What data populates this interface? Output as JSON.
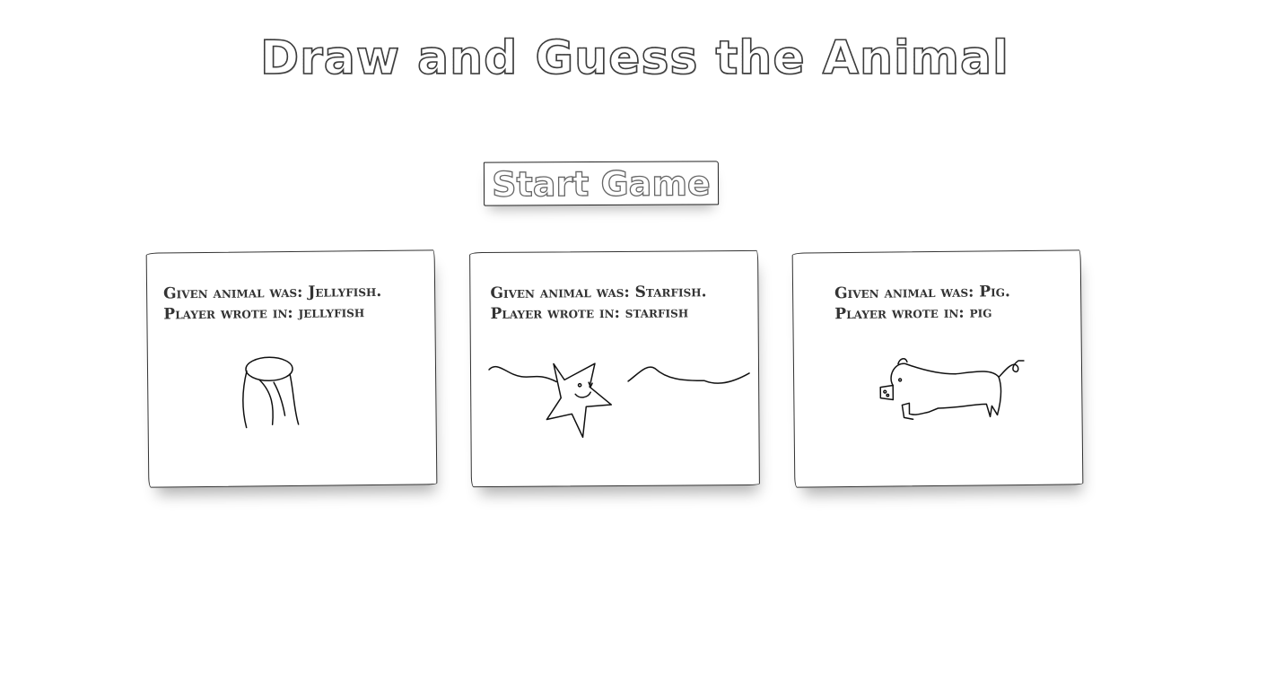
{
  "page": {
    "title": "Draw and Guess the Animal"
  },
  "controls": {
    "start_label": "Start Game"
  },
  "cards": [
    {
      "given": "Given animal was: Jellyfish.",
      "wrote": "Player wrote in: jellyfish",
      "drawing": "jellyfish-drawing"
    },
    {
      "given": "Given animal was: Starfish.",
      "wrote": "Player wrote in: starfish",
      "drawing": "starfish-drawing"
    },
    {
      "given": "Given animal was: Pig.",
      "wrote": "Player wrote in: pig",
      "drawing": "pig-drawing"
    }
  ]
}
